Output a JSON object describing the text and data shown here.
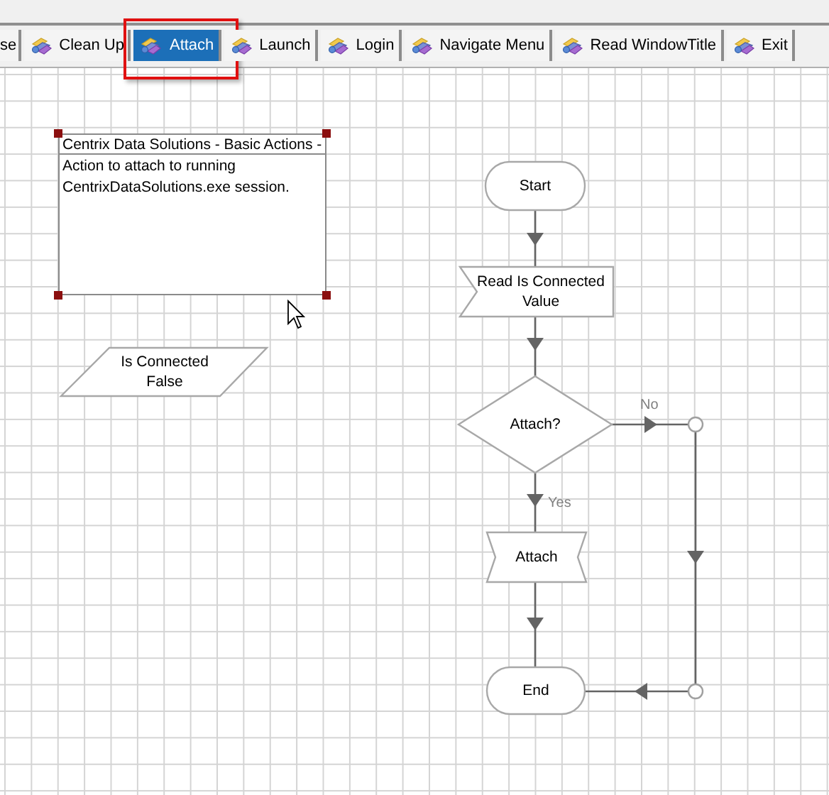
{
  "tabs": [
    {
      "label": "se",
      "icon": false,
      "selected": false,
      "highlighted": false
    },
    {
      "label": "Clean Up",
      "icon": true,
      "selected": false,
      "highlighted": false
    },
    {
      "label": "Attach",
      "icon": true,
      "selected": true,
      "highlighted": true
    },
    {
      "label": "Launch",
      "icon": true,
      "selected": false,
      "highlighted": false
    },
    {
      "label": "Login",
      "icon": true,
      "selected": false,
      "highlighted": false
    },
    {
      "label": "Navigate Menu",
      "icon": true,
      "selected": false,
      "highlighted": false
    },
    {
      "label": "Read WindowTitle",
      "icon": true,
      "selected": false,
      "highlighted": false
    },
    {
      "label": "Exit",
      "icon": true,
      "selected": false,
      "highlighted": false
    }
  ],
  "note": {
    "title": "Centrix Data Solutions - Basic Actions -",
    "body_lines": [
      "Action to attach to running",
      "CentrixDataSolutions.exe session."
    ],
    "selected": true
  },
  "variable": {
    "lines": [
      "Is Connected",
      "False"
    ]
  },
  "flow": {
    "nodes": [
      {
        "kind": "terminal",
        "lines": [
          "Start"
        ]
      },
      {
        "kind": "read",
        "lines": [
          "Read Is Connected",
          "Value"
        ]
      },
      {
        "kind": "decision",
        "lines": [
          "Attach?"
        ]
      },
      {
        "kind": "action",
        "lines": [
          "Attach"
        ]
      },
      {
        "kind": "terminal",
        "lines": [
          "End"
        ]
      }
    ],
    "labels": {
      "no": "No",
      "yes": "Yes"
    }
  }
}
